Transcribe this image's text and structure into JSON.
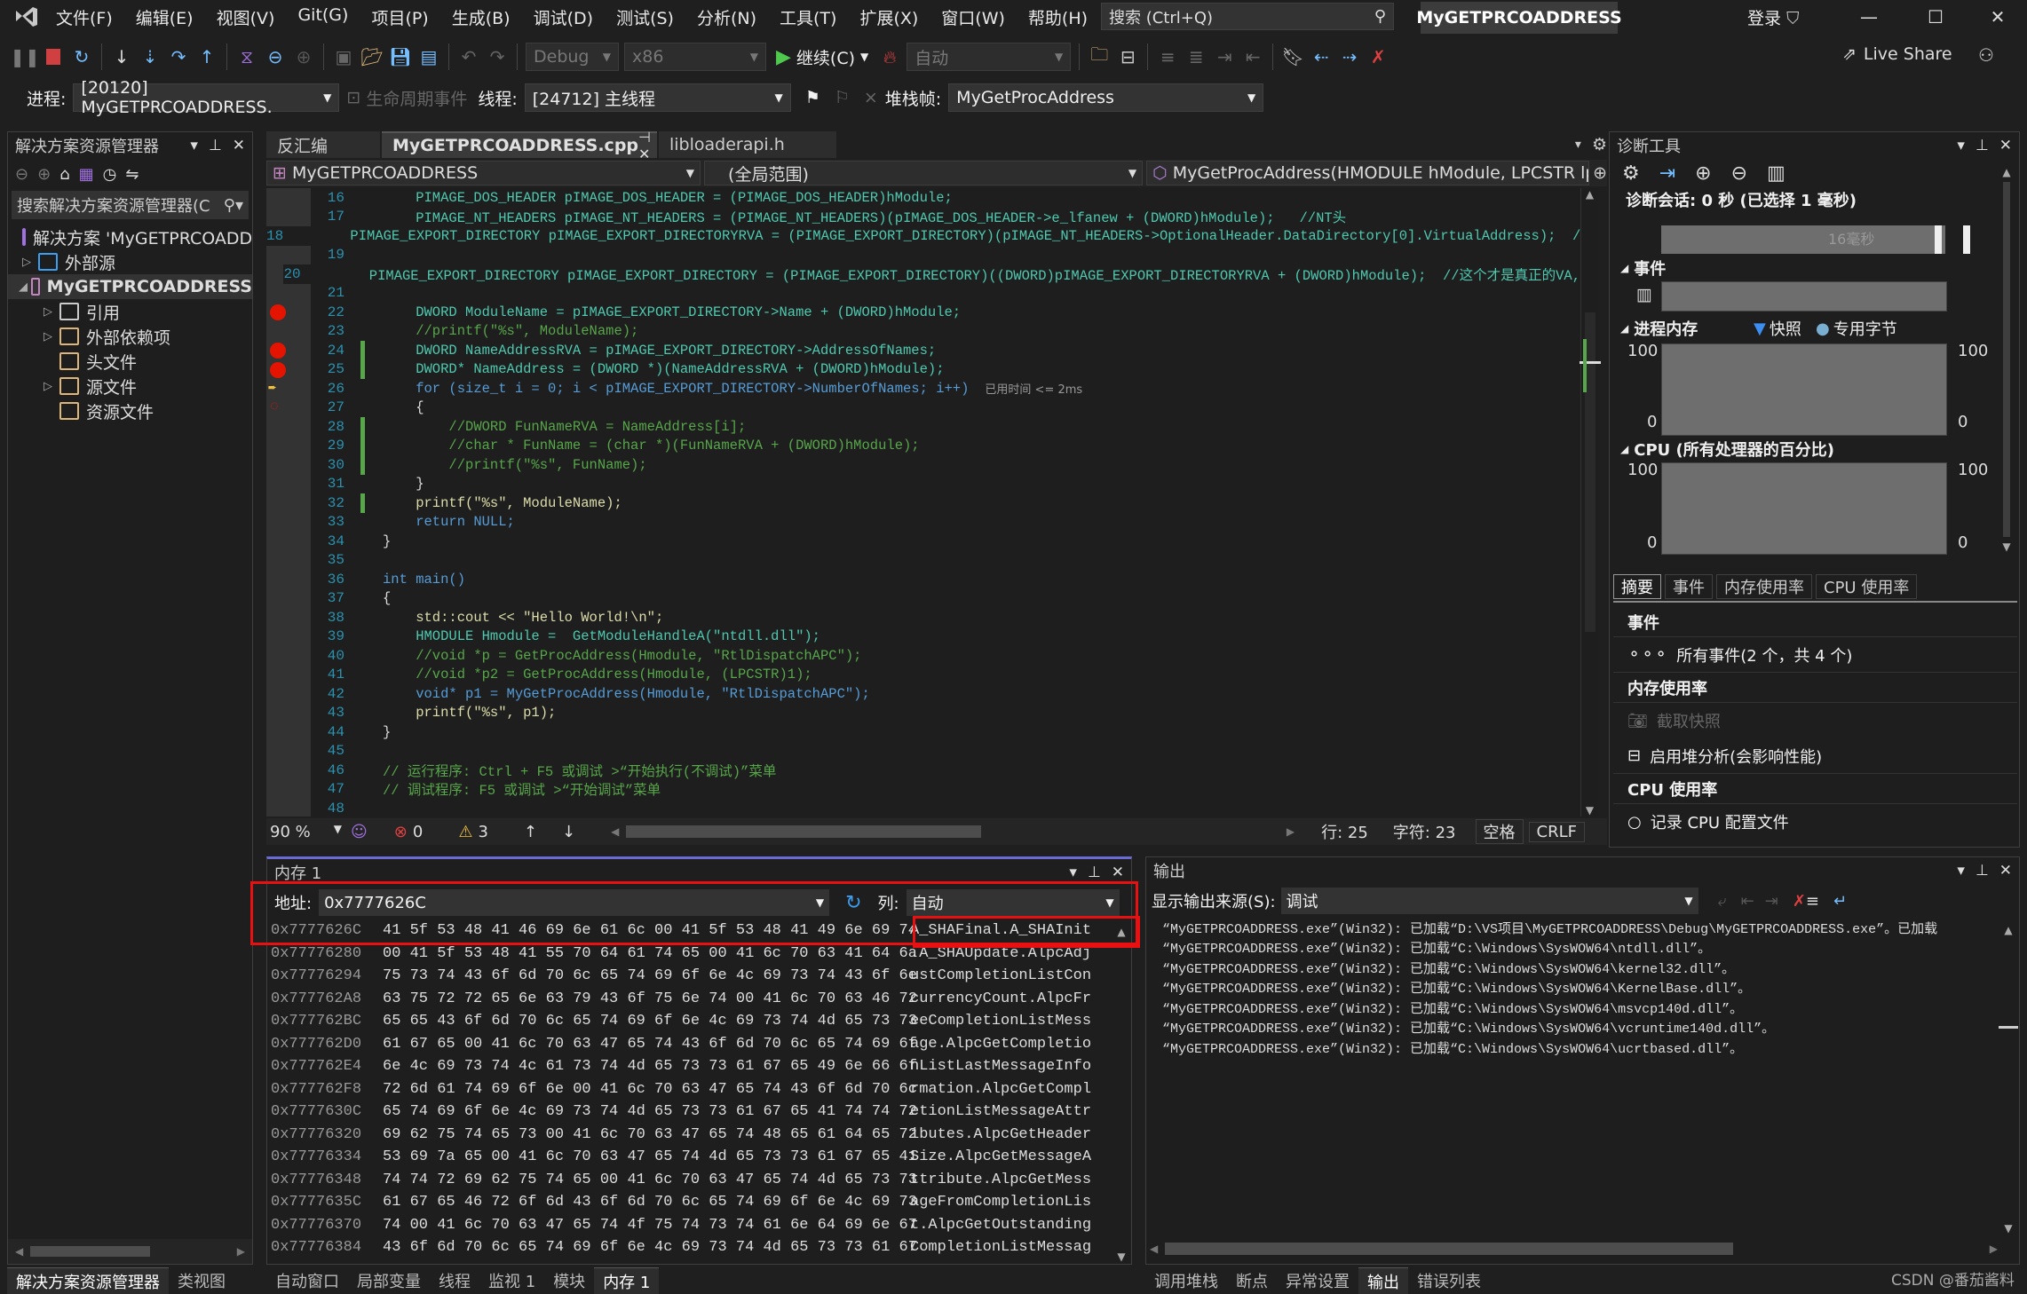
{
  "window": {
    "menu": [
      "文件(F)",
      "编辑(E)",
      "视图(V)",
      "Git(G)",
      "项目(P)",
      "生成(B)",
      "调试(D)",
      "测试(S)",
      "分析(N)",
      "工具(T)",
      "扩展(X)",
      "窗口(W)",
      "帮助(H)"
    ],
    "search_placeholder": "搜索 (Ctrl+Q)",
    "solution_name": "MyGETPRCOADDRESS",
    "login": "登录",
    "live_share": "Live Share"
  },
  "toolbar": {
    "config": "Debug",
    "platform": "x86",
    "continue_label": "继续(C)",
    "auto_label": "自动"
  },
  "debug_location": {
    "process_label": "进程:",
    "process_value": "[20120] MyGETPRCOADDRESS.",
    "lifecycle_label": "生命周期事件",
    "thread_label": "线程:",
    "thread_value": "[24712] 主线程",
    "stackframe_label": "堆栈帧:",
    "stackframe_value": "MyGetProcAddress"
  },
  "solution_explorer": {
    "title": "解决方案资源管理器",
    "search_placeholder": "搜索解决方案资源管理器(C",
    "items": [
      {
        "label": "解决方案 'MyGETPRCOADDRESS'",
        "level": 0,
        "expander": ""
      },
      {
        "label": "外部源",
        "level": 0,
        "expander": "▷"
      },
      {
        "label": "MyGETPRCOADDRESS",
        "level": 0,
        "expander": "◢",
        "bold": true
      },
      {
        "label": "引用",
        "level": 1,
        "expander": "▷"
      },
      {
        "label": "外部依赖项",
        "level": 1,
        "expander": "▷"
      },
      {
        "label": "头文件",
        "level": 1,
        "expander": ""
      },
      {
        "label": "源文件",
        "level": 1,
        "expander": "▷"
      },
      {
        "label": "资源文件",
        "level": 1,
        "expander": ""
      }
    ],
    "bottom_tabs": [
      "解决方案资源管理器",
      "类视图"
    ]
  },
  "editor": {
    "tabs": [
      {
        "label": "反汇编",
        "active": false
      },
      {
        "label": "MyGETPRCOADDRESS.cpp",
        "active": true
      },
      {
        "label": "libloaderapi.h",
        "active": false
      }
    ],
    "nav_project": "MyGETPRCOADDRESS",
    "nav_scope": "(全局范围)",
    "nav_member": "MyGetProcAddress(HMODULE hModule, LPCSTR lp",
    "lines": [
      {
        "n": 16,
        "text": "    PIMAGE_DOS_HEADER pIMAGE_DOS_HEADER = (PIMAGE_DOS_HEADER)hModule;"
      },
      {
        "n": 17,
        "text": "    PIMAGE_NT_HEADERS pIMAGE_NT_HEADERS = (PIMAGE_NT_HEADERS)(pIMAGE_DOS_HEADER->e_lfanew + (DWORD)hModule);   //NT头"
      },
      {
        "n": 18,
        "text": "    PIMAGE_EXPORT_DIRECTORY pIMAGE_EXPORT_DIRECTORYRVA = (PIMAGE_EXPORT_DIRECTORY)(pIMAGE_NT_HEADERS->OptionalHeader.DataDirectory[0].VirtualAddress);  //"
      },
      {
        "n": 19,
        "text": ""
      },
      {
        "n": 20,
        "text": "    PIMAGE_EXPORT_DIRECTORY pIMAGE_EXPORT_DIRECTORY = (PIMAGE_EXPORT_DIRECTORY)((DWORD)pIMAGE_EXPORT_DIRECTORYRVA + (DWORD)hModule);  //这个才是真正的VA,"
      },
      {
        "n": 21,
        "text": ""
      },
      {
        "n": 22,
        "text": "    DWORD ModuleName = pIMAGE_EXPORT_DIRECTORY->Name + (DWORD)hModule;"
      },
      {
        "n": 23,
        "text": "    //printf(\"%s\", ModuleName);"
      },
      {
        "n": 24,
        "text": "    DWORD NameAddressRVA = pIMAGE_EXPORT_DIRECTORY->AddressOfNames;"
      },
      {
        "n": 25,
        "text": "    DWORD* NameAddress = (DWORD *)(NameAddressRVA + (DWORD)hModule);"
      },
      {
        "n": 26,
        "text": "    for (size_t i = 0; i < pIMAGE_EXPORT_DIRECTORY->NumberOfNames; i++)"
      },
      {
        "n": 27,
        "text": "    {"
      },
      {
        "n": 28,
        "text": "        //DWORD FunNameRVA = NameAddress[i];"
      },
      {
        "n": 29,
        "text": "        //char * FunName = (char *)(FunNameRVA + (DWORD)hModule);"
      },
      {
        "n": 30,
        "text": "        //printf(\"%s\", FunName);"
      },
      {
        "n": 31,
        "text": "    }"
      },
      {
        "n": 32,
        "text": "    printf(\"%s\", ModuleName);"
      },
      {
        "n": 33,
        "text": "    return NULL;"
      },
      {
        "n": 34,
        "text": "}"
      },
      {
        "n": 35,
        "text": ""
      },
      {
        "n": 36,
        "text": "int main()"
      },
      {
        "n": 37,
        "text": "{"
      },
      {
        "n": 38,
        "text": "    std::cout << \"Hello World!\\n\";"
      },
      {
        "n": 39,
        "text": "    HMODULE Hmodule =  GetModuleHandleA(\"ntdll.dll\");"
      },
      {
        "n": 40,
        "text": "    //void *p = GetProcAddress(Hmodule, \"RtlDispatchAPC\");"
      },
      {
        "n": 41,
        "text": "    //void *p2 = GetProcAddress(Hmodule, (LPCSTR)1);"
      },
      {
        "n": 42,
        "text": "    void* p1 = MyGetProcAddress(Hmodule, \"RtlDispatchAPC\");"
      },
      {
        "n": 43,
        "text": "    printf(\"%s\", p1);"
      },
      {
        "n": 44,
        "text": "}"
      },
      {
        "n": 45,
        "text": ""
      },
      {
        "n": 46,
        "text": "// 运行程序: Ctrl + F5 或调试 >“开始执行(不调试)”菜单"
      },
      {
        "n": 47,
        "text": "// 调试程序: F5 或调试 >“开始调试”菜单"
      },
      {
        "n": 48,
        "text": ""
      }
    ],
    "elapsed_hint": "已用时间 <= 2ms",
    "status": {
      "zoom": "90 %",
      "errors": "0",
      "warnings": "3",
      "line": "行: 25",
      "char": "字符: 23",
      "whitespace": "空格",
      "eol": "CRLF"
    }
  },
  "diagnostics": {
    "title": "诊断工具",
    "session": "诊断会话: 0 秒 (已选择 1 毫秒)",
    "timeline_label": "16毫秒",
    "events_header": "事件",
    "process_memory_header": "进程内存",
    "legend_snapshot": "快照",
    "legend_private_bytes": "专用字节",
    "cpu_header": "CPU (所有处理器的百分比)",
    "axis_max": "100",
    "axis_min": "0",
    "tabs": [
      "摘要",
      "事件",
      "内存使用率",
      "CPU 使用率"
    ],
    "summary": {
      "events_title": "事件",
      "all_events": "所有事件(2 个，共 4 个)",
      "memory_title": "内存使用率",
      "take_snapshot": "截取快照",
      "heap_profiling": "启用堆分析(会影响性能)",
      "cpu_title": "CPU 使用率",
      "record_cpu": "记录 CPU 配置文件"
    }
  },
  "memory": {
    "title": "内存 1",
    "address_label": "地址:",
    "address_value": "0x7777626C",
    "columns_label": "列:",
    "columns_value": "自动",
    "rows": [
      {
        "addr": "0x7777626C",
        "hex": "41 5f 53 48 41 46 69 6e 61 6c 00 41 5f 53 48 41 49 6e 69 74",
        "ascii": "A_SHAFinal.A_SHAInit"
      },
      {
        "addr": "0x77776280",
        "hex": "00 41 5f 53 48 41 55 70 64 61 74 65 00 41 6c 70 63 41 64 6a",
        "ascii": ".A_SHAUpdate.AlpcAdj"
      },
      {
        "addr": "0x77776294",
        "hex": "75 73 74 43 6f 6d 70 6c 65 74 69 6f 6e 4c 69 73 74 43 6f 6e",
        "ascii": "ustCompletionListCon"
      },
      {
        "addr": "0x777762A8",
        "hex": "63 75 72 72 65 6e 63 79 43 6f 75 6e 74 00 41 6c 70 63 46 72",
        "ascii": "currencyCount.AlpcFr"
      },
      {
        "addr": "0x777762BC",
        "hex": "65 65 43 6f 6d 70 6c 65 74 69 6f 6e 4c 69 73 74 4d 65 73 73",
        "ascii": "eeCompletionListMess"
      },
      {
        "addr": "0x777762D0",
        "hex": "61 67 65 00 41 6c 70 63 47 65 74 43 6f 6d 70 6c 65 74 69 6f",
        "ascii": "age.AlpcGetCompletio"
      },
      {
        "addr": "0x777762E4",
        "hex": "6e 4c 69 73 74 4c 61 73 74 4d 65 73 73 61 67 65 49 6e 66 6f",
        "ascii": "nListLastMessageInfo"
      },
      {
        "addr": "0x777762F8",
        "hex": "72 6d 61 74 69 6f 6e 00 41 6c 70 63 47 65 74 43 6f 6d 70 6c",
        "ascii": "rmation.AlpcGetCompl"
      },
      {
        "addr": "0x7777630C",
        "hex": "65 74 69 6f 6e 4c 69 73 74 4d 65 73 73 61 67 65 41 74 74 72",
        "ascii": "etionListMessageAttr"
      },
      {
        "addr": "0x77776320",
        "hex": "69 62 75 74 65 73 00 41 6c 70 63 47 65 74 48 65 61 64 65 72",
        "ascii": "ibutes.AlpcGetHeader"
      },
      {
        "addr": "0x77776334",
        "hex": "53 69 7a 65 00 41 6c 70 63 47 65 74 4d 65 73 73 61 67 65 41",
        "ascii": "Size.AlpcGetMessageA"
      },
      {
        "addr": "0x77776348",
        "hex": "74 74 72 69 62 75 74 65 00 41 6c 70 63 47 65 74 4d 65 73 73",
        "ascii": "ttribute.AlpcGetMess"
      },
      {
        "addr": "0x7777635C",
        "hex": "61 67 65 46 72 6f 6d 43 6f 6d 70 6c 65 74 69 6f 6e 4c 69 73",
        "ascii": "ageFromCompletionLis"
      },
      {
        "addr": "0x77776370",
        "hex": "74 00 41 6c 70 63 47 65 74 4f 75 74 73 74 61 6e 64 69 6e 67",
        "ascii": "t.AlpcGetOutstanding"
      },
      {
        "addr": "0x77776384",
        "hex": "43 6f 6d 70 6c 65 74 69 6f 6e 4c 69 73 74 4d 65 73 73 61 67",
        "ascii": "CompletionListMessag"
      }
    ],
    "bottom_tabs": [
      {
        "label": "自动窗口",
        "active": false
      },
      {
        "label": "局部变量",
        "active": false
      },
      {
        "label": "线程",
        "active": false
      },
      {
        "label": "监视 1",
        "active": false
      },
      {
        "label": "模块",
        "active": false
      },
      {
        "label": "内存 1",
        "active": true
      }
    ]
  },
  "output": {
    "title": "输出",
    "source_label": "显示输出来源(S):",
    "source_value": "调试",
    "lines": [
      "“MyGETPRCOADDRESS.exe”(Win32): 已加载“D:\\VS项目\\MyGETPRCOADDRESS\\Debug\\MyGETPRCOADDRESS.exe”。已加载",
      "“MyGETPRCOADDRESS.exe”(Win32): 已加载“C:\\Windows\\SysWOW64\\ntdll.dll”。",
      "“MyGETPRCOADDRESS.exe”(Win32): 已加载“C:\\Windows\\SysWOW64\\kernel32.dll”。",
      "“MyGETPRCOADDRESS.exe”(Win32): 已加载“C:\\Windows\\SysWOW64\\KernelBase.dll”。",
      "“MyGETPRCOADDRESS.exe”(Win32): 已加载“C:\\Windows\\SysWOW64\\msvcp140d.dll”。",
      "“MyGETPRCOADDRESS.exe”(Win32): 已加载“C:\\Windows\\SysWOW64\\vcruntime140d.dll”。",
      "“MyGETPRCOADDRESS.exe”(Win32): 已加载“C:\\Windows\\SysWOW64\\ucrtbased.dll”。"
    ],
    "bottom_tabs": [
      {
        "label": "调用堆栈",
        "active": false
      },
      {
        "label": "断点",
        "active": false
      },
      {
        "label": "异常设置",
        "active": false
      },
      {
        "label": "输出",
        "active": true
      },
      {
        "label": "错误列表",
        "active": false
      }
    ]
  },
  "watermark": "CSDN @番茄酱料",
  "colors": {
    "accent": "#007acc",
    "breakpoint": "#e51400",
    "highlight_box": "#e81010",
    "memory_tab_accent": "#6b6bd6"
  }
}
